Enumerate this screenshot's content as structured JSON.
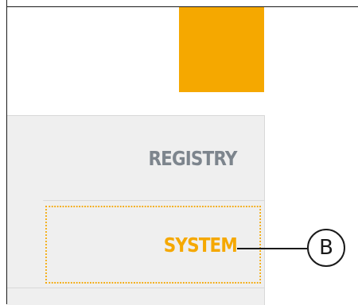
{
  "menu": {
    "items": [
      {
        "label": "REGISTRY",
        "state": "normal"
      },
      {
        "label": "SYSTEM",
        "state": "focused"
      }
    ]
  },
  "callout": {
    "label": "B"
  },
  "colors": {
    "accent": "#f5a800",
    "menu_text": "#7d858d",
    "menu_background": "#efefef"
  }
}
